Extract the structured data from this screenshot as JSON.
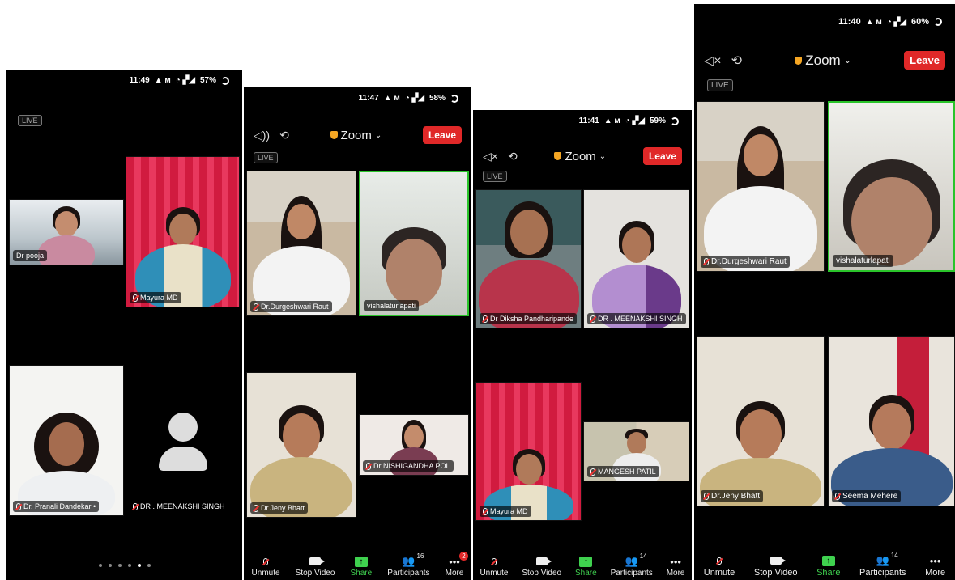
{
  "screens": [
    {
      "status": {
        "time": "11:49",
        "battery": "57%"
      },
      "live_label": "LIVE",
      "tiles": [
        {
          "name": "Dr pooja"
        },
        {
          "name": "Mayura MD"
        },
        {
          "name": "Dr. Pranali Dandekar •"
        },
        {
          "name": "DR . MEENAKSHI SINGH"
        }
      ]
    },
    {
      "status": {
        "time": "11:47",
        "battery": "58%"
      },
      "title": "Zoom",
      "leave_label": "Leave",
      "live_label": "LIVE",
      "tiles": [
        {
          "name": "Dr.Durgeshwari Raut"
        },
        {
          "name": "vishalaturlapati"
        },
        {
          "name": "Dr.Jeny Bhatt"
        },
        {
          "name": "Dr NISHIGANDHA POL"
        }
      ],
      "toolbar": {
        "unmute": "Unmute",
        "stop_video": "Stop Video",
        "share": "Share",
        "participants": "Participants",
        "participants_count": "16",
        "more": "More",
        "more_badge": "2"
      }
    },
    {
      "status": {
        "time": "11:41",
        "battery": "59%"
      },
      "title": "Zoom",
      "leave_label": "Leave",
      "live_label": "LIVE",
      "tiles": [
        {
          "name": "Dr Diksha Pandharipande"
        },
        {
          "name": "DR . MEENAKSHI SINGH"
        },
        {
          "name": "Mayura MD"
        },
        {
          "name": "MANGESH PATIL"
        }
      ],
      "toolbar": {
        "unmute": "Unmute",
        "stop_video": "Stop Video",
        "share": "Share",
        "participants": "Participants",
        "participants_count": "14",
        "more": "More"
      }
    },
    {
      "status": {
        "time": "11:40",
        "battery": "60%"
      },
      "title": "Zoom",
      "leave_label": "Leave",
      "live_label": "LIVE",
      "tiles": [
        {
          "name": "Dr.Durgeshwari Raut"
        },
        {
          "name": "vishalaturlapati"
        },
        {
          "name": "Dr.Jeny Bhatt"
        },
        {
          "name": "Seema Mehere"
        }
      ],
      "toolbar": {
        "unmute": "Unmute",
        "stop_video": "Stop Video",
        "share": "Share",
        "participants": "Participants",
        "participants_count": "14",
        "more": "More"
      }
    }
  ],
  "colors": {
    "leave": "#e02828",
    "share": "#3fd14f",
    "active_speaker": "#2ac42a"
  }
}
